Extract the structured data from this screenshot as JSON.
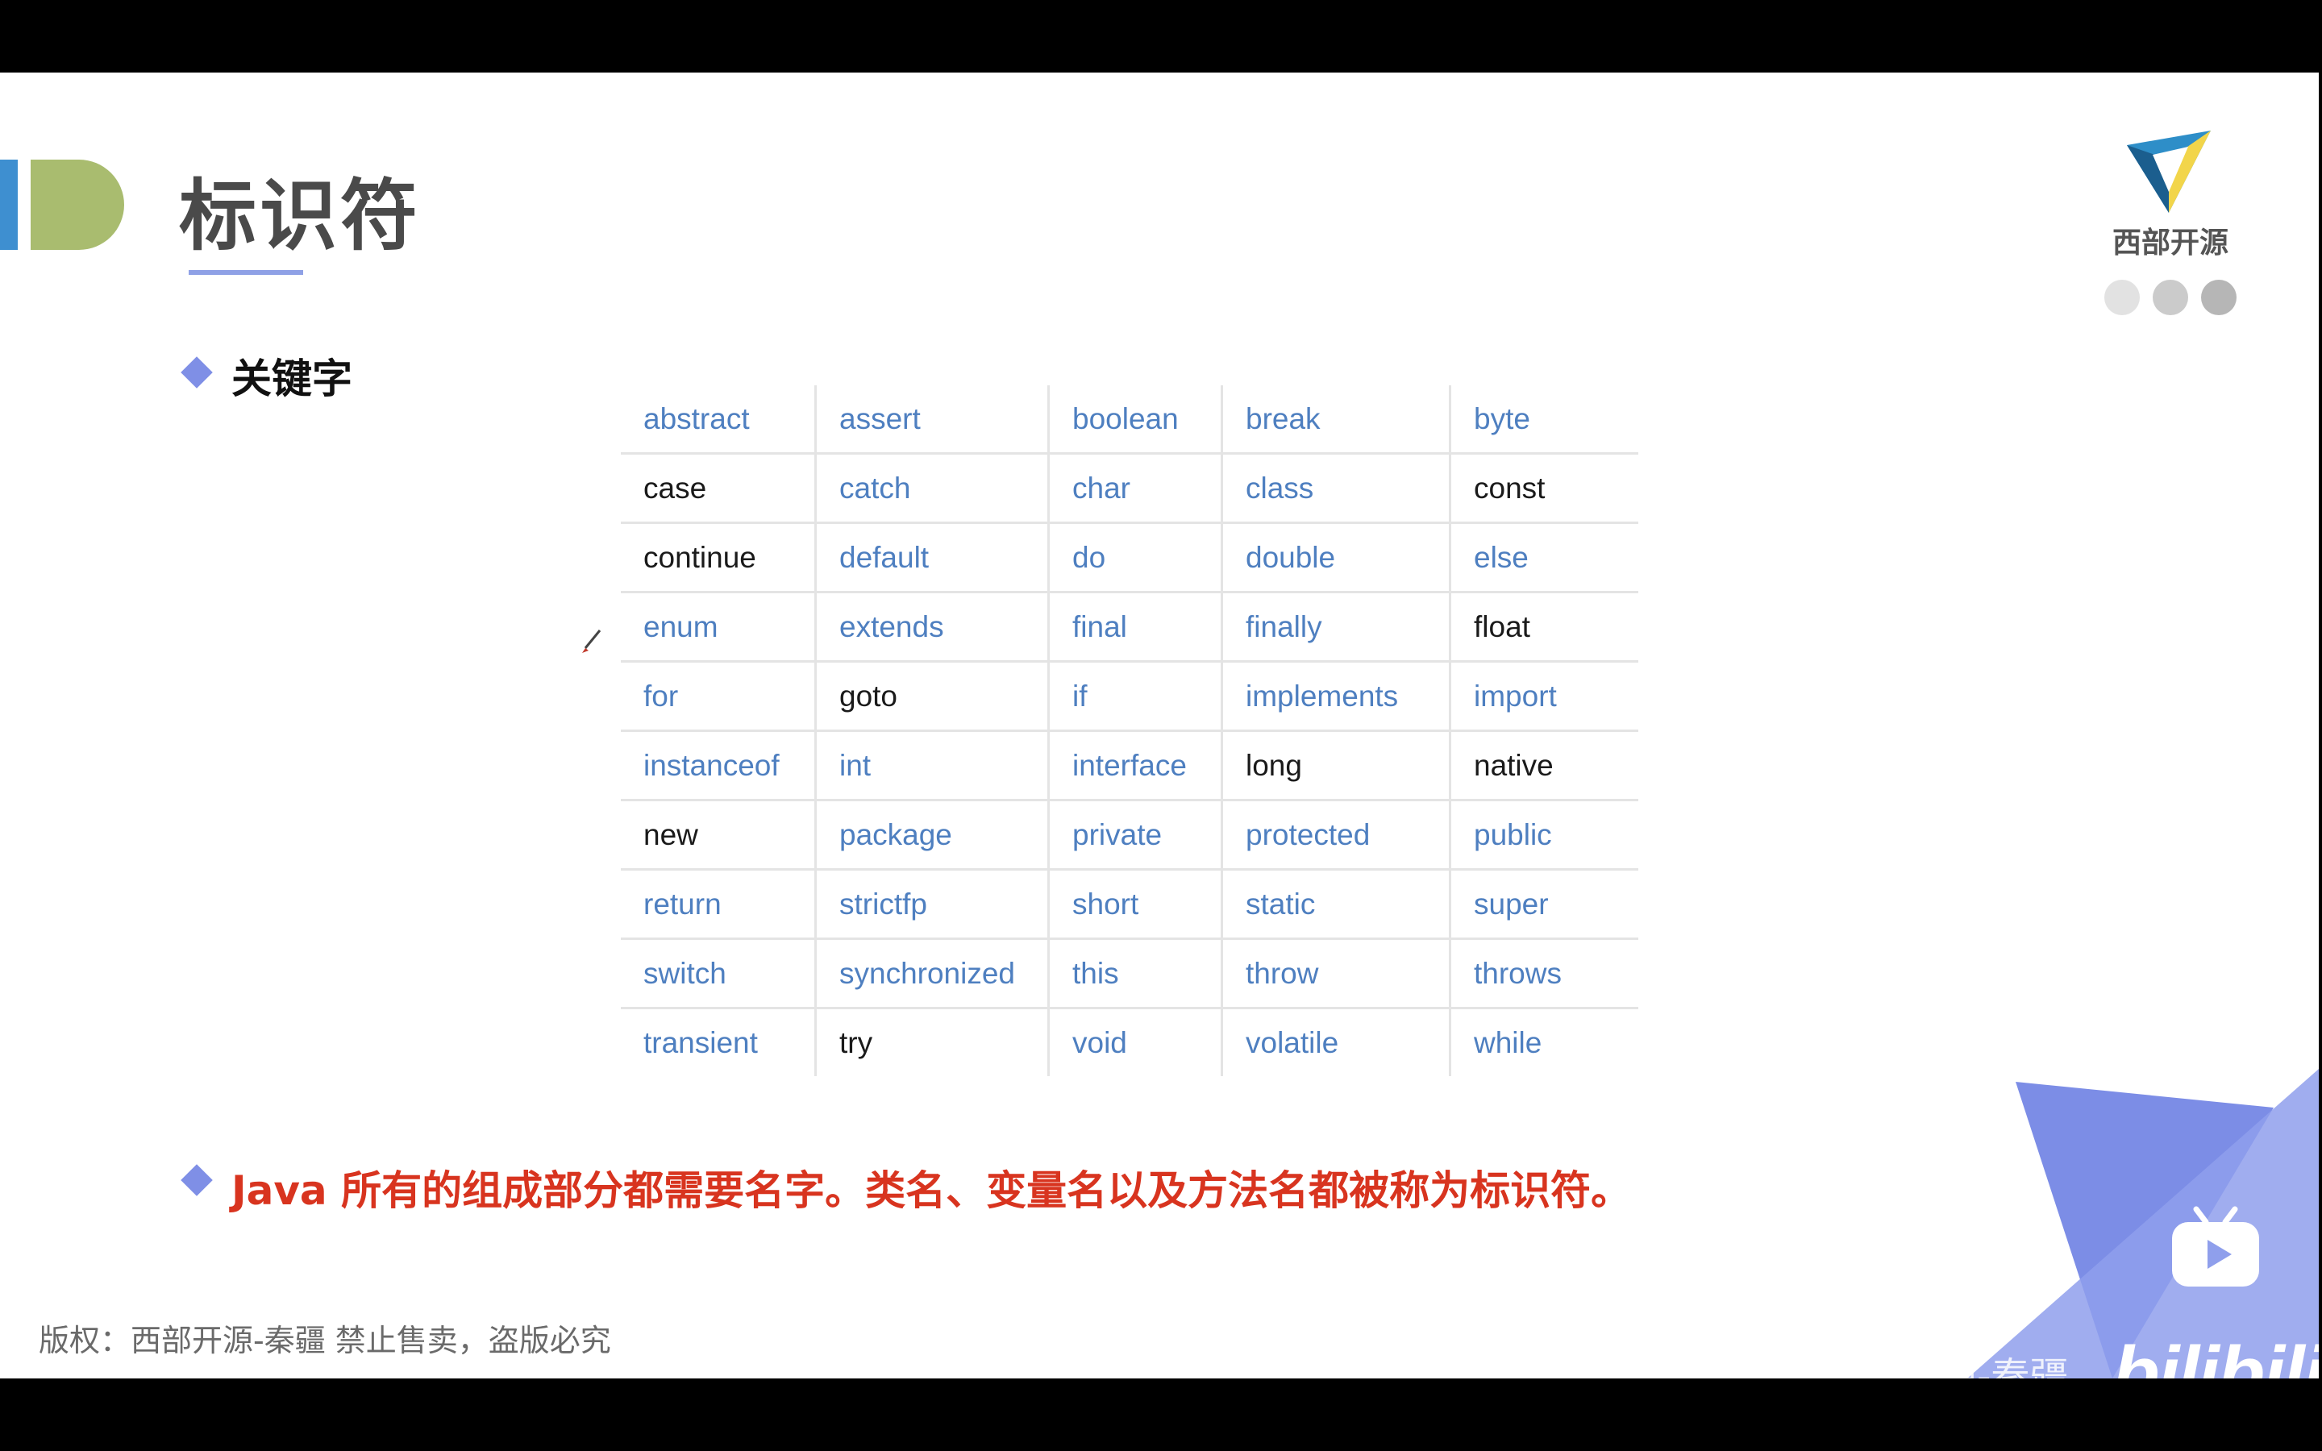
{
  "slide": {
    "title": "标识符",
    "logo_text": "西部开源",
    "bullets": [
      {
        "text": "关键字"
      },
      {
        "text": "Java 所有的组成部分都需要名字。类名、变量名以及方法名都被称为标识符。"
      }
    ],
    "keywords_table": [
      [
        {
          "t": "abstract",
          "dark": false
        },
        {
          "t": "assert",
          "dark": false
        },
        {
          "t": "boolean",
          "dark": false
        },
        {
          "t": "break",
          "dark": false
        },
        {
          "t": "byte",
          "dark": false
        }
      ],
      [
        {
          "t": "case",
          "dark": true
        },
        {
          "t": "catch",
          "dark": false
        },
        {
          "t": "char",
          "dark": false
        },
        {
          "t": "class",
          "dark": false
        },
        {
          "t": "const",
          "dark": true
        }
      ],
      [
        {
          "t": "continue",
          "dark": true
        },
        {
          "t": "default",
          "dark": false
        },
        {
          "t": "do",
          "dark": false
        },
        {
          "t": "double",
          "dark": false
        },
        {
          "t": "else",
          "dark": false
        }
      ],
      [
        {
          "t": "enum",
          "dark": false
        },
        {
          "t": "extends",
          "dark": false
        },
        {
          "t": "final",
          "dark": false
        },
        {
          "t": "finally",
          "dark": false
        },
        {
          "t": "float",
          "dark": true
        }
      ],
      [
        {
          "t": "for",
          "dark": false
        },
        {
          "t": "goto",
          "dark": true
        },
        {
          "t": "if",
          "dark": false
        },
        {
          "t": "implements",
          "dark": false
        },
        {
          "t": "import",
          "dark": false
        }
      ],
      [
        {
          "t": "instanceof",
          "dark": false
        },
        {
          "t": "int",
          "dark": false
        },
        {
          "t": "interface",
          "dark": false
        },
        {
          "t": "long",
          "dark": true
        },
        {
          "t": "native",
          "dark": true
        }
      ],
      [
        {
          "t": "new",
          "dark": true
        },
        {
          "t": "package",
          "dark": false
        },
        {
          "t": "private",
          "dark": false
        },
        {
          "t": "protected",
          "dark": false
        },
        {
          "t": "public",
          "dark": false
        }
      ],
      [
        {
          "t": "return",
          "dark": false
        },
        {
          "t": "strictfp",
          "dark": false
        },
        {
          "t": "short",
          "dark": false
        },
        {
          "t": "static",
          "dark": false
        },
        {
          "t": "super",
          "dark": false
        }
      ],
      [
        {
          "t": "switch",
          "dark": false
        },
        {
          "t": "synchronized",
          "dark": false
        },
        {
          "t": "this",
          "dark": false
        },
        {
          "t": "throw",
          "dark": false
        },
        {
          "t": "throws",
          "dark": false
        }
      ],
      [
        {
          "t": "transient",
          "dark": false
        },
        {
          "t": "try",
          "dark": true
        },
        {
          "t": "void",
          "dark": false
        },
        {
          "t": "volatile",
          "dark": false
        },
        {
          "t": "while",
          "dark": false
        }
      ]
    ],
    "copyright": "版权：西部开源-秦疆    禁止售卖，盗版必究"
  },
  "watermark": {
    "brand": "bilibili",
    "channel_text": "西部开源-秦疆"
  },
  "icons": {
    "play": "play-icon",
    "pen": "pen-cursor-icon",
    "logo": "logo-mark-icon"
  },
  "colors": {
    "accent_blue": "#3e8fd0",
    "accent_green": "#a9bc6f",
    "keyword_blue": "#4e7fc0",
    "highlight_red": "#d8341f",
    "diamond": "#7f8fe6"
  }
}
